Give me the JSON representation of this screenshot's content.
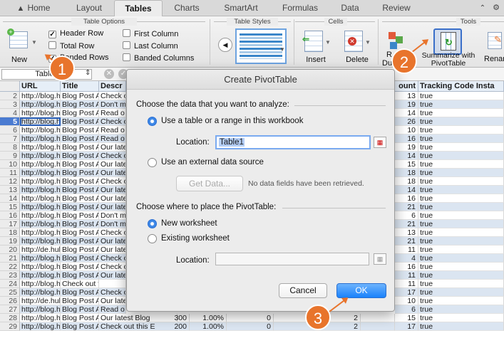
{
  "tabs": {
    "home": "Home",
    "layout": "Layout",
    "tables": "Tables",
    "charts": "Charts",
    "smartart": "SmartArt",
    "formulas": "Formulas",
    "data": "Data",
    "review": "Review"
  },
  "ribbon": {
    "table_options": "Table Options",
    "table_styles": "Table Styles",
    "cells": "Cells",
    "tools": "Tools",
    "new": "New",
    "header_row": "Header Row",
    "total_row": "Total Row",
    "banded_rows": "Banded Rows",
    "first_column": "First Column",
    "last_column": "Last Column",
    "banded_columns": "Banded Columns",
    "insert": "Insert",
    "delete": "Delete",
    "remove_dup_partial": "R",
    "remove_dup_partial2": "Du",
    "summarize": "Summarize with",
    "pivottable": "PivotTable",
    "rename": "Renam"
  },
  "formula_bar": {
    "name_box": "Table1"
  },
  "columns": {
    "url": "URL",
    "title": "Title",
    "desc": "Descr",
    "count": "ount",
    "tracking": "Tracking Code Insta"
  },
  "rows": [
    {
      "n": "2",
      "url": "http://blog.hu",
      "title": "Blog Post A",
      "desc": "Check o",
      "count": "13",
      "flag": "true"
    },
    {
      "n": "3",
      "url": "http://blog.hu",
      "title": "Blog Post A",
      "desc": "Don't m",
      "count": "19",
      "flag": "true"
    },
    {
      "n": "4",
      "url": "http://blog.hu",
      "title": "Blog Post A",
      "desc": "Read o",
      "count": "14",
      "flag": "true"
    },
    {
      "n": "5",
      "url": "http://blog.hu",
      "title": "Blog Post A",
      "desc": "Check o",
      "count": "26",
      "flag": "true"
    },
    {
      "n": "6",
      "url": "http://blog.hu",
      "title": "Blog Post A",
      "desc": "Read o",
      "count": "10",
      "flag": "true"
    },
    {
      "n": "7",
      "url": "http://blog.hu",
      "title": "Blog Post A",
      "desc": "Read o",
      "count": "16",
      "flag": "true"
    },
    {
      "n": "8",
      "url": "http://blog.hu",
      "title": "Blog Post A",
      "desc": "Our late",
      "count": "19",
      "flag": "true"
    },
    {
      "n": "9",
      "url": "http://blog.hu",
      "title": "Blog Post A",
      "desc": "Check o",
      "count": "14",
      "flag": "true"
    },
    {
      "n": "10",
      "url": "http://blog.hu",
      "title": "Blog Post A",
      "desc": "Our late",
      "count": "15",
      "flag": "true"
    },
    {
      "n": "11",
      "url": "http://blog.hu",
      "title": "Blog Post A",
      "desc": "Our late",
      "count": "18",
      "flag": "true"
    },
    {
      "n": "12",
      "url": "http://blog.hu",
      "title": "Blog Post A",
      "desc": "Check o",
      "count": "18",
      "flag": "true"
    },
    {
      "n": "13",
      "url": "http://blog.hu",
      "title": "Blog Post A",
      "desc": "Our late",
      "count": "14",
      "flag": "true"
    },
    {
      "n": "14",
      "url": "http://blog.hu",
      "title": "Blog Post A",
      "desc": "Our late",
      "count": "16",
      "flag": "true"
    },
    {
      "n": "15",
      "url": "http://blog.hu",
      "title": "Blog Post A",
      "desc": "Our late",
      "count": "21",
      "flag": "true"
    },
    {
      "n": "16",
      "url": "http://blog.hu",
      "title": "Blog Post A",
      "desc": "Don't m",
      "count": "6",
      "flag": "true"
    },
    {
      "n": "17",
      "url": "http://blog.hu",
      "title": "Blog Post A",
      "desc": "Don't m",
      "count": "21",
      "flag": "true"
    },
    {
      "n": "18",
      "url": "http://blog.hu",
      "title": "Blog Post A",
      "desc": "Check o",
      "count": "13",
      "flag": "true"
    },
    {
      "n": "19",
      "url": "http://blog.hu",
      "title": "Blog Post A",
      "desc": "Our late",
      "count": "21",
      "flag": "true"
    },
    {
      "n": "20",
      "url": "http://de.hub",
      "title": "Blog Post A",
      "desc": "Our late",
      "count": "11",
      "flag": "true"
    },
    {
      "n": "21",
      "url": "http://blog.hu",
      "title": "Blog Post A",
      "desc": "Check o",
      "count": "4",
      "flag": "true"
    },
    {
      "n": "22",
      "url": "http://blog.hu",
      "title": "Blog Post A",
      "desc": "Check o",
      "count": "16",
      "flag": "true"
    },
    {
      "n": "23",
      "url": "http://blog.hu",
      "title": "Blog Post A",
      "desc": "Our late",
      "count": "11",
      "flag": "true"
    },
    {
      "n": "24",
      "url": "http://blog.hu",
      "title": "Check out this E",
      "desc": "",
      "count": "11",
      "flag": "true"
    },
    {
      "n": "25",
      "url": "http://blog.hu",
      "title": "Blog Post A",
      "desc": "Check o",
      "count": "17",
      "flag": "true"
    },
    {
      "n": "26",
      "url": "http://de.hub",
      "title": "Blog Post A",
      "desc": "Our late",
      "count": "10",
      "flag": "true"
    },
    {
      "n": "27",
      "url": "http://blog.hu",
      "title": "Blog Post A",
      "desc": "Read o",
      "count": "6",
      "flag": "true"
    },
    {
      "n": "28",
      "url": "http://blog.hu",
      "title": "Blog Post A",
      "desc": "Our latest Blog",
      "v1": "300",
      "v2": "1.00%",
      "v3": "0",
      "v4": "2",
      "count": "15",
      "flag": "true"
    },
    {
      "n": "29",
      "url": "http://blog.hu",
      "title": "Blog Post A",
      "desc": "Check out this E",
      "v1": "200",
      "v2": "1.00%",
      "v3": "0",
      "v4": "2",
      "count": "17",
      "flag": "true"
    }
  ],
  "dialog": {
    "title": "Create PivotTable",
    "choose_data": "Choose the data that you want to analyze:",
    "use_table": "Use a table or a range in this workbook",
    "location_label": "Location:",
    "location_value": "Table1",
    "use_external": "Use an external data source",
    "get_data": "Get Data...",
    "no_data": "No data fields have been retrieved.",
    "choose_where": "Choose where to place the PivotTable:",
    "new_worksheet": "New worksheet",
    "existing_worksheet": "Existing worksheet",
    "location2_label": "Location:",
    "location2_value": "",
    "cancel": "Cancel",
    "ok": "OK"
  },
  "callouts": {
    "one": "1",
    "two": "2",
    "three": "3"
  },
  "colors": {
    "accent": "#e8742c",
    "band": "#dbe5f1",
    "ok": "#1a82fb"
  }
}
